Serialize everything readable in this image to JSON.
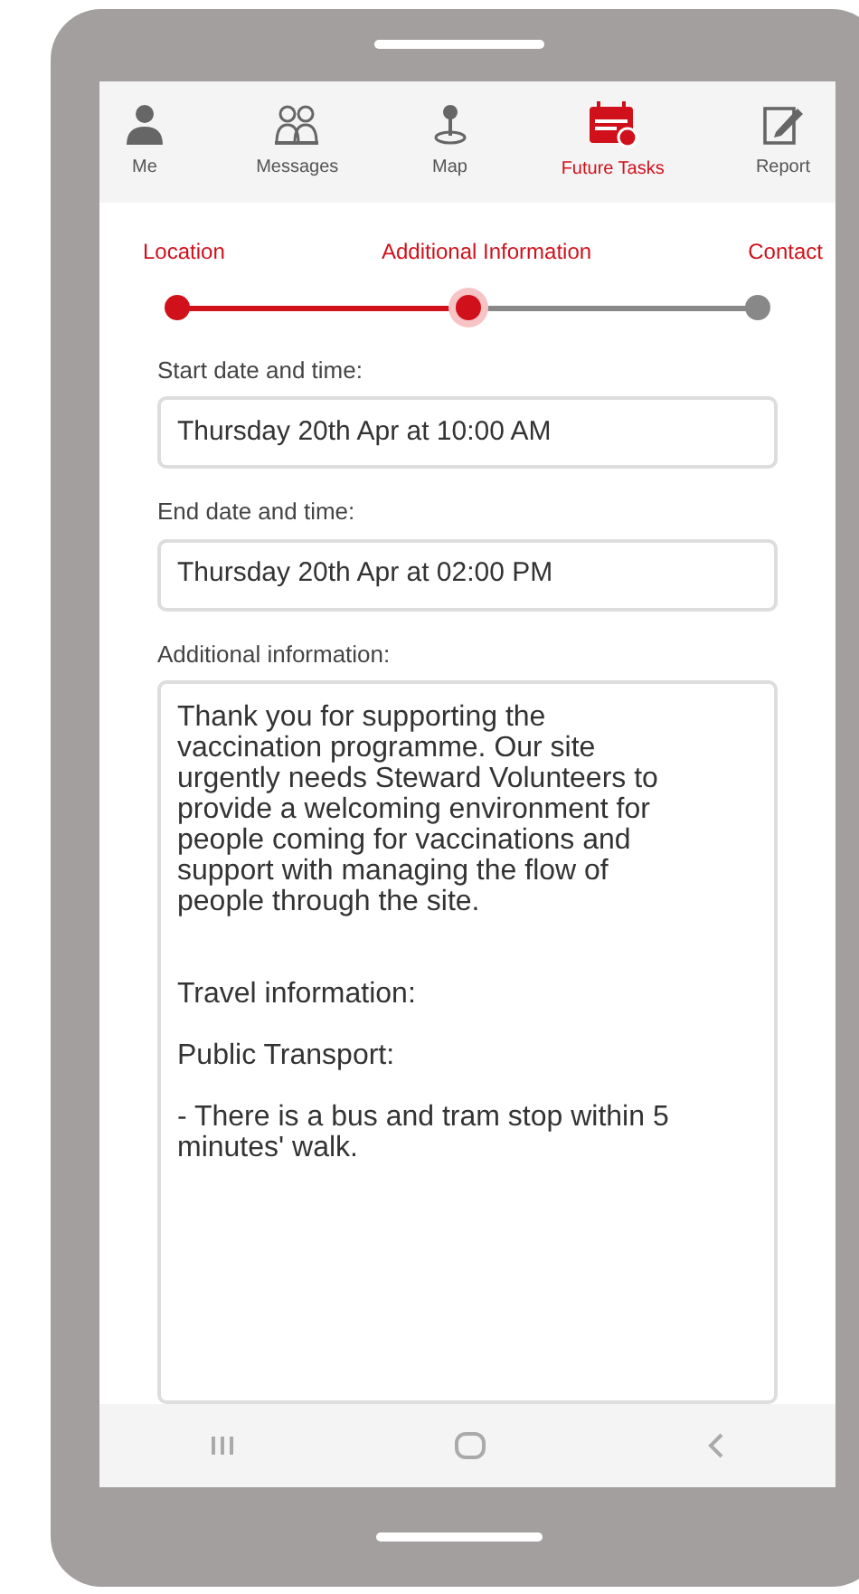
{
  "tabs": [
    {
      "label": "Me",
      "selected": false
    },
    {
      "label": "Messages",
      "selected": false
    },
    {
      "label": "Map",
      "selected": false
    },
    {
      "label": "Future Tasks",
      "selected": true
    },
    {
      "label": "Report",
      "selected": false
    }
  ],
  "steps": [
    {
      "label": "Location",
      "done": true,
      "selected": false
    },
    {
      "label": "Additional Information",
      "done": true,
      "selected": true
    },
    {
      "label": "Contact",
      "done": false,
      "selected": false
    }
  ],
  "fields": [
    {
      "label": "Start date and time:",
      "value": "Thursday 20th Apr at 10:00 AM"
    },
    {
      "label": "End date and time:",
      "value": "Thursday 20th Apr at 02:00 PM"
    }
  ],
  "additional_information": {
    "label": "Additional information:",
    "text": "Thank you for supporting the vaccination programme. Our site urgently needs Steward Volunteers to provide a welcoming environment for people coming for vaccinations and support with managing the flow of people through the site.\n\n\nTravel information:\n\nPublic Transport:\n\n- There is a bus and tram stop within 5 minutes' walk."
  }
}
